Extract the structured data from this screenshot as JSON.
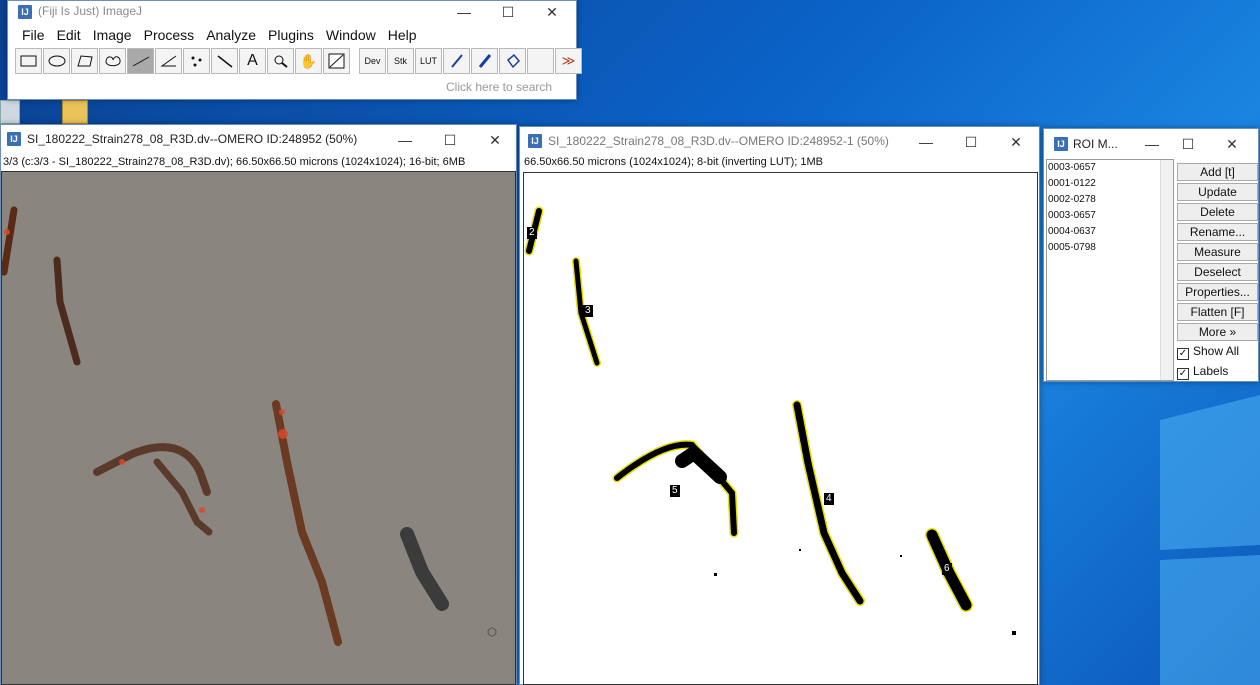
{
  "imagej": {
    "title": "(Fiji Is Just) ImageJ",
    "menu": [
      "File",
      "Edit",
      "Image",
      "Process",
      "Analyze",
      "Plugins",
      "Window",
      "Help"
    ],
    "tools_text": {
      "dev": "Dev",
      "stk": "Stk",
      "lut": "LUT",
      "more": "≫"
    },
    "search_placeholder": "Click here to search"
  },
  "image_window_1": {
    "title": "SI_180222_Strain278_08_R3D.dv--OMERO ID:248952 (50%)",
    "info": "3/3 (c:3/3 - SI_180222_Strain278_08_R3D.dv); 66.50x66.50 microns (1024x1024); 16-bit; 6MB"
  },
  "image_window_2": {
    "title": "SI_180222_Strain278_08_R3D.dv--OMERO ID:248952-1 (50%)",
    "info": "66.50x66.50 microns (1024x1024); 8-bit (inverting LUT); 1MB",
    "labels": [
      "2",
      "3",
      "5",
      "4",
      "6"
    ]
  },
  "roi_manager": {
    "title": "ROI M...",
    "items": [
      "0003-0657",
      "0001-0122",
      "0002-0278",
      "0003-0657",
      "0004-0637",
      "0005-0798"
    ],
    "buttons": [
      "Add [t]",
      "Update",
      "Delete",
      "Rename...",
      "Measure",
      "Deselect",
      "Properties...",
      "Flatten [F]",
      "More »"
    ],
    "checks": [
      {
        "label": "Show All",
        "checked": true
      },
      {
        "label": "Labels",
        "checked": true
      }
    ]
  },
  "window_controls": {
    "minimize": "—",
    "maximize": "☐",
    "close": "✕"
  },
  "colors": {
    "desktop_blue": "#0b63c8",
    "roi_outline": "#e8e000",
    "phase_bg": "#8b8680",
    "cell_fluor": "#c0391b"
  }
}
